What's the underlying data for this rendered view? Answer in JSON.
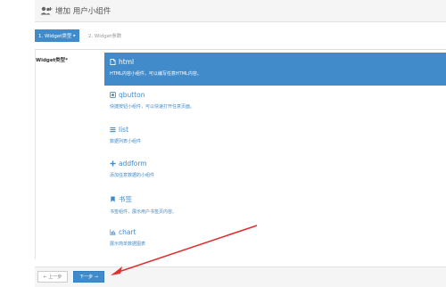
{
  "header": {
    "title": "增加 用户小组件",
    "icon": "user-plus-icon"
  },
  "steps": [
    {
      "label": "1. Widget类型",
      "arrow": "▸",
      "active": true
    },
    {
      "label": "2. Widget参数",
      "active": false
    }
  ],
  "form": {
    "label": "Widget类型",
    "required_mark": "*",
    "options": [
      {
        "icon": "file-icon",
        "title": "html",
        "desc": "HTML内容小组件，可以编写任意HTML内容。",
        "selected": true
      },
      {
        "icon": "square-icon",
        "title": "qbutton",
        "desc": "快捷按钮小组件，可以快速打开任意页面。",
        "selected": false
      },
      {
        "icon": "list-icon",
        "title": "list",
        "desc": "数据列表小组件",
        "selected": false
      },
      {
        "icon": "plus-icon",
        "title": "addform",
        "desc": "添加任意数据的小组件",
        "selected": false
      },
      {
        "icon": "bookmark-icon",
        "title": "书签",
        "desc": "书签组件，展示用户书签页内容。",
        "selected": false
      },
      {
        "icon": "bar-chart-icon",
        "title": "chart",
        "desc": "展示简单数据图表",
        "selected": false
      }
    ]
  },
  "footer": {
    "prev_label": "← 上一步",
    "next_label": "下一步 →"
  },
  "colors": {
    "primary": "#428bca",
    "annotation": "#e03030"
  }
}
